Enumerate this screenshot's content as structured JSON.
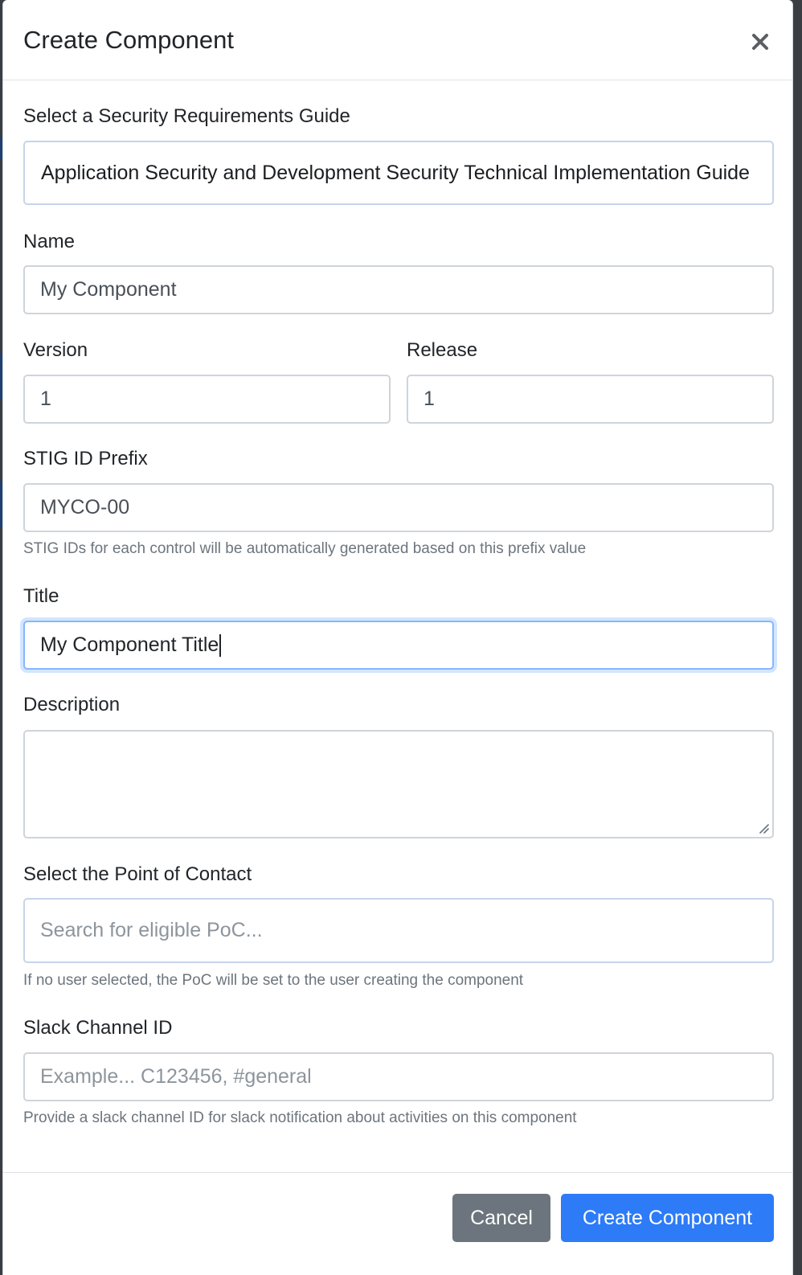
{
  "modal": {
    "title": "Create Component",
    "close_label": "×"
  },
  "form": {
    "srg": {
      "label": "Select a Security Requirements Guide",
      "value": "Application Security and Development Security Technical Implementation Guide"
    },
    "name": {
      "label": "Name",
      "value": "My Component"
    },
    "version": {
      "label": "Version",
      "value": "1"
    },
    "release": {
      "label": "Release",
      "value": "1"
    },
    "stig_prefix": {
      "label": "STIG ID Prefix",
      "value": "MYCO-00",
      "help": "STIG IDs for each control will be automatically generated based on this prefix value"
    },
    "title": {
      "label": "Title",
      "value": "My Component Title"
    },
    "description": {
      "label": "Description",
      "value": ""
    },
    "poc": {
      "label": "Select the Point of Contact",
      "placeholder": "Search for eligible PoC...",
      "help": "If no user selected, the PoC will be set to the user creating the component"
    },
    "slack": {
      "label": "Slack Channel ID",
      "placeholder": "Example... C123456, #general",
      "help": "Provide a slack channel ID for slack notification about activities on this component"
    }
  },
  "footer": {
    "cancel_label": "Cancel",
    "create_label": "Create Component"
  },
  "colors": {
    "primary": "#2d7bf7",
    "secondary": "#6c757d",
    "focus_border": "#86b7fe"
  },
  "icons": {
    "close": "close-icon",
    "resize": "resize-grip-icon"
  }
}
